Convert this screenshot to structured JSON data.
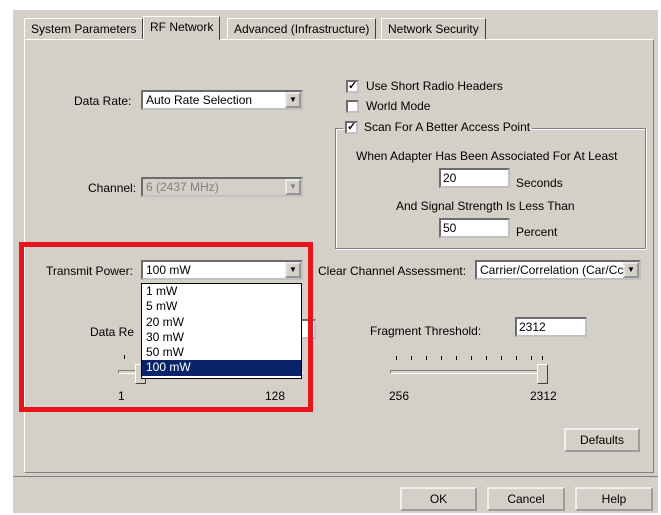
{
  "tabs": [
    {
      "label": "System Parameters"
    },
    {
      "label": "RF Network"
    },
    {
      "label": "Advanced (Infrastructure)"
    },
    {
      "label": "Network Security"
    }
  ],
  "data_rate": {
    "label": "Data Rate:",
    "value": "Auto Rate Selection"
  },
  "channel": {
    "label": "Channel:",
    "value": "6  (2437 MHz)"
  },
  "transmit_power": {
    "label": "Transmit Power:",
    "value": "100 mW",
    "options": [
      "1 mW",
      "5 mW",
      "20 mW",
      "30 mW",
      "50 mW",
      "100 mW"
    ],
    "selected_index": 5
  },
  "checkboxes": {
    "short_headers": {
      "label": "Use Short Radio Headers",
      "checked": true
    },
    "world_mode": {
      "label": "World Mode",
      "checked": false
    },
    "scan": {
      "label": "Scan For A Better Access Point",
      "checked": true
    }
  },
  "scan_group": {
    "associated_text": "When Adapter Has Been Associated For At Least",
    "seconds_value": "20",
    "seconds_unit": "Seconds",
    "signal_text": "And Signal Strength Is Less Than",
    "percent_value": "50",
    "percent_unit": "Percent"
  },
  "cca": {
    "label": "Clear Channel Assessment:",
    "value": "Carrier/Correlation (Car/Cc"
  },
  "data_retries": {
    "label_partial": "Data Re",
    "min": "1",
    "max": "128"
  },
  "fragment": {
    "label": "Fragment Threshold:",
    "value": "2312",
    "min": "256",
    "max": "2312"
  },
  "buttons": {
    "defaults": "Defaults",
    "ok": "OK",
    "cancel": "Cancel",
    "help": "Help"
  },
  "colors": {
    "highlight": "#e8141c",
    "selection": "#0a246a",
    "dialog_bg": "#d4d0c8"
  }
}
